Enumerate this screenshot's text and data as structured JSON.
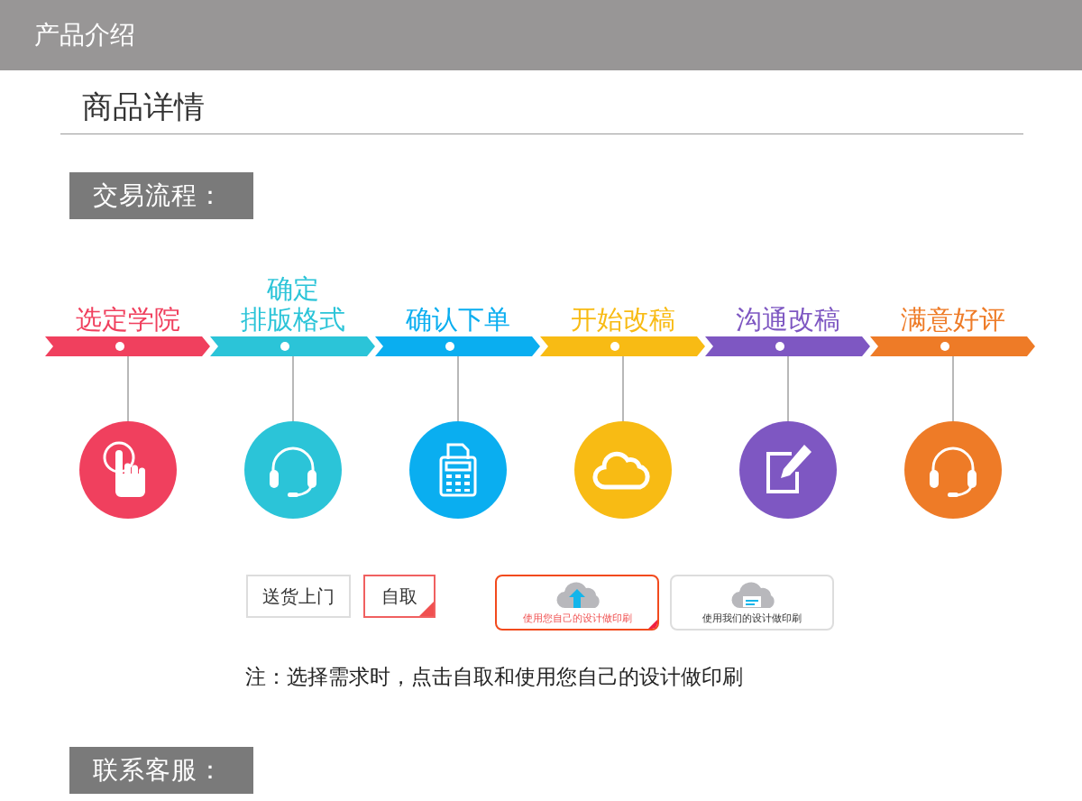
{
  "header": {
    "title": "产品介绍"
  },
  "page_title": "商品详情",
  "process_section": {
    "label": "交易流程："
  },
  "steps": [
    {
      "label_lines": [
        "选定学院"
      ],
      "color": "#f0405e",
      "kind": "hand"
    },
    {
      "label_lines": [
        "确定",
        "排版格式"
      ],
      "color": "#2bc4d8",
      "kind": "headset"
    },
    {
      "label_lines": [
        "确认下单"
      ],
      "color": "#0aaef0",
      "kind": "calculator"
    },
    {
      "label_lines": [
        "开始改稿"
      ],
      "color": "#f8bb14",
      "kind": "cloud"
    },
    {
      "label_lines": [
        "沟通改稿"
      ],
      "color": "#7e57c2",
      "kind": "edit"
    },
    {
      "label_lines": [
        "满意好评"
      ],
      "color": "#ee7b27",
      "kind": "headset"
    }
  ],
  "delivery_options": [
    {
      "label": "送货上门",
      "selected": false
    },
    {
      "label": "自取",
      "selected": true
    }
  ],
  "design_options": [
    {
      "label": "使用您自己的设计做印刷",
      "kind": "upload",
      "selected": true
    },
    {
      "label": "使用我们的设计做印刷",
      "kind": "document",
      "selected": false
    }
  ],
  "note": "注：选择需求时，点击自取和使用您自己的设计做印刷",
  "contact_section": {
    "label": "联系客服："
  }
}
